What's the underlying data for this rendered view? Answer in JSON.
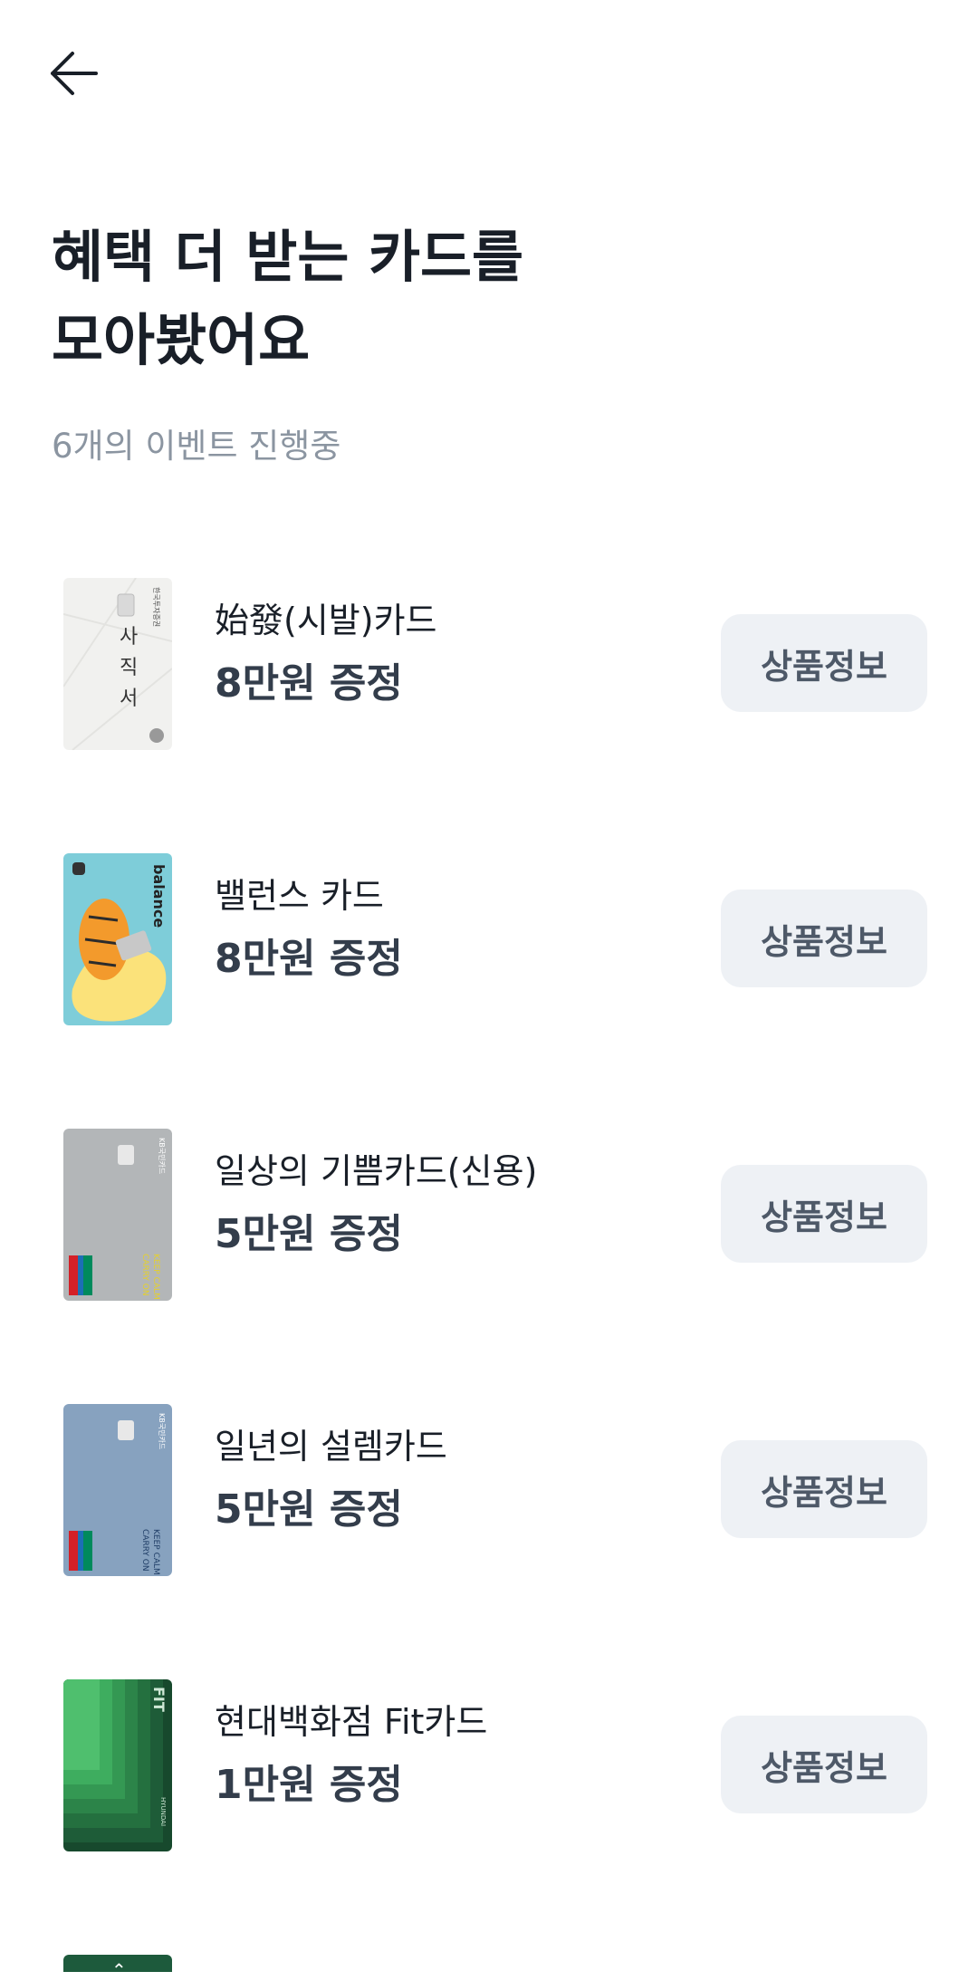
{
  "header": {
    "back_icon": "arrow-left-icon"
  },
  "title_lines": [
    "혜택 더 받는 카드를",
    "모아봤어요"
  ],
  "subtitle": "6개의 이벤트 진행중",
  "cards": [
    {
      "name": "始發(시발)카드",
      "reward": "8만원 증정",
      "button": "상품정보",
      "card_text": "사\n직\n서",
      "art": "paper"
    },
    {
      "name": "밸런스 카드",
      "reward": "8만원 증정",
      "button": "상품정보",
      "card_text": "balance",
      "art": "tiger"
    },
    {
      "name": "일상의 기쁨카드(신용)",
      "reward": "5만원 증정",
      "button": "상품정보",
      "card_text": "KEEP CALM AND CARRY ON",
      "art": "gray"
    },
    {
      "name": "일년의 설렘카드",
      "reward": "5만원 증정",
      "button": "상품정보",
      "card_text": "KEEP CALM AND CARRY ON",
      "art": "blue"
    },
    {
      "name": "현대백화점 Fit카드",
      "reward": "1만원 증정",
      "button": "상품정보",
      "card_text": "FIT",
      "art": "green"
    }
  ],
  "colors": {
    "title": "#191f28",
    "subtitle": "#8b95a1",
    "reward": "#333d4b",
    "button_bg": "#eef1f5",
    "button_text": "#4e5968"
  }
}
